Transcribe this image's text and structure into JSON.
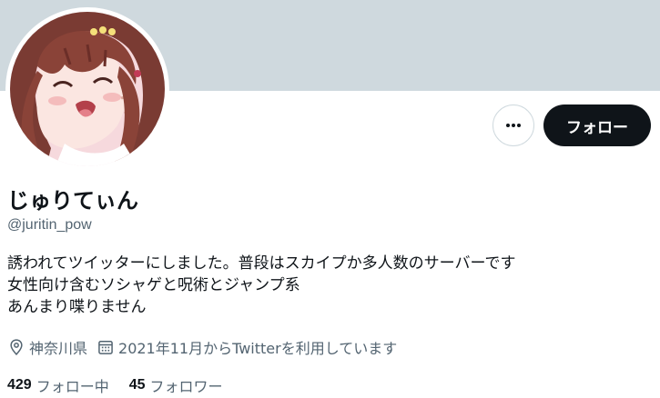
{
  "profile": {
    "display_name": "じゅりてぃん",
    "handle": "@juritin_pow",
    "bio_lines": [
      "誘われてツイッターにしました。普段はスカイプか多人数のサーバーです",
      "女性向け含むソシャゲと呪術とジャンプ系",
      "あんまり喋りません"
    ],
    "location": "神奈川県",
    "joined": "2021年11月からTwitterを利用しています",
    "following_count": "429",
    "following_label": "フォロー中",
    "followers_count": "45",
    "followers_label": "フォロワー"
  },
  "actions": {
    "follow_label": "フォロー",
    "more_icon": "more-horizontal-icon"
  },
  "colors": {
    "banner": "#cfd9de",
    "secondary_text": "#536471",
    "primary_text": "#0f1419",
    "button_bg": "#0f1419"
  }
}
